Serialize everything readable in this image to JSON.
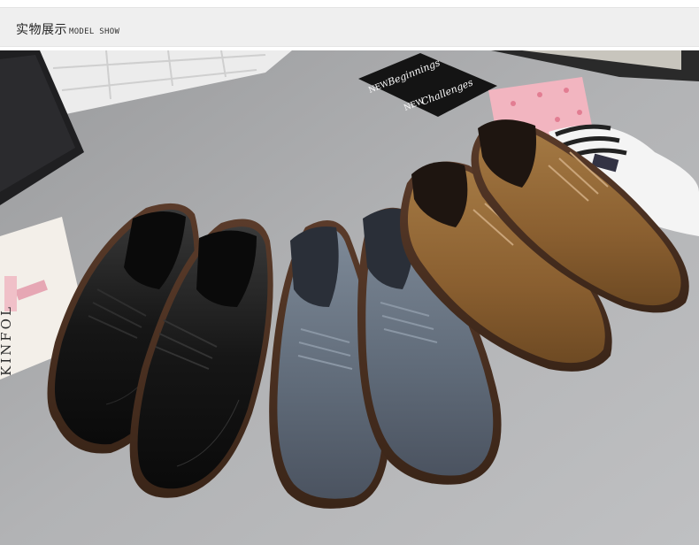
{
  "header": {
    "title": "实物展示",
    "subtitle": "MODEL SHOW"
  },
  "photo": {
    "card_new_1": "NEW",
    "card_beginnings": "Beginnings",
    "card_new_2": "NEW",
    "card_challenges": "Challenges",
    "magazine_text": "KINFOL",
    "shoe_colors": [
      "black",
      "grey-blue",
      "tan-brown"
    ]
  }
}
